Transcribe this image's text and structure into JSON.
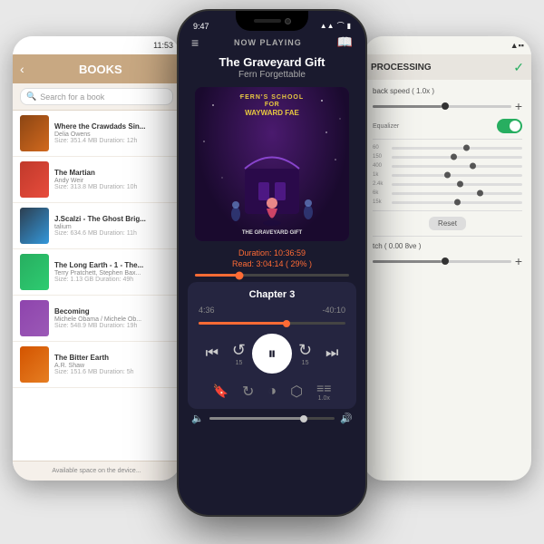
{
  "scene": {
    "background_color": "#e8e8e8"
  },
  "left_phone": {
    "status_time": "11:53",
    "header_title": "BOOKS",
    "back_label": "‹",
    "search_placeholder": "Search for a book",
    "books": [
      {
        "title": "Where the Crawdads Sin...",
        "author": "Delia Owens",
        "meta": "Size: 351.4 MB  Duration: 12h",
        "thumb_class": "thumb-1"
      },
      {
        "title": "The Martian",
        "author": "Andy Weir",
        "meta": "Size: 313.8 MB  Duration: 10h",
        "thumb_class": "thumb-2"
      },
      {
        "title": "J.Scalzi - The Ghost Brig...",
        "author": "talium",
        "meta": "Size: 634.6 MB  Duration: 11h",
        "thumb_class": "thumb-3"
      },
      {
        "title": "The Long Earth - 1 - The...",
        "author": "Terry Pratchett, Stephen Bax...",
        "meta": "Size: 1.13 GB  Duration: 49h",
        "thumb_class": "thumb-4"
      },
      {
        "title": "Becoming",
        "author": "Michele Obama / Michele Ob...",
        "meta": "Size: 548.9 MB  Duration: 19h",
        "thumb_class": "thumb-5"
      },
      {
        "title": "The Bitter Earth",
        "author": "A.R. Shaw",
        "meta": "Size: 151.6 MB  Duration: 5h",
        "thumb_class": "thumb-6"
      }
    ],
    "bottom_text": "Available space on the device..."
  },
  "right_phone": {
    "header_label": "PROCESSING",
    "playback_label": "back speed ( 1.0x )",
    "equalizer_label": "Equalizer",
    "reset_label": "Reset",
    "pitch_label": "tch ( 0.00 8ve )",
    "bands": [
      {
        "label": "60",
        "pos": 55
      },
      {
        "label": "150",
        "pos": 45
      },
      {
        "label": "400",
        "pos": 60
      },
      {
        "label": "1k",
        "pos": 40
      },
      {
        "label": "2.4k",
        "pos": 50
      },
      {
        "label": "6k",
        "pos": 65
      },
      {
        "label": "15k",
        "pos": 48
      }
    ]
  },
  "center_phone": {
    "status_time": "9:47",
    "now_playing_label": "NOW PLAYING",
    "book_title": "The Graveyard Gift",
    "book_author": "Fern Forgettable",
    "art_line1": "FERN'S SCHOOL",
    "art_line2": "FOR",
    "art_line3": "WAYWARD FAE",
    "art_bottom": "THE GRAVEYARD GIFT",
    "duration_label": "Duration: 10:36:59",
    "read_label": "Read: 3:04:14 ( 29% )",
    "chapter_label": "Chapter 3",
    "time_current": "4:36",
    "time_remaining": "-40:10",
    "vol_icon_left": "🔈",
    "vol_icon_right": "🔊",
    "speed_label": "1.0x",
    "controls": {
      "rewind": "«",
      "back15": "15",
      "pause": "⏸",
      "forward15": "15",
      "forward": "»"
    },
    "bottom_icons": {
      "bookmark": "🔖",
      "refresh": "↻",
      "sleep": "◑",
      "airplay": "⬡",
      "equalizer": "≡"
    }
  }
}
